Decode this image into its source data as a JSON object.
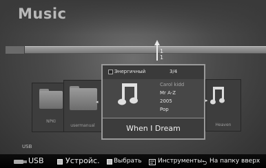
{
  "app": {
    "title": "Music"
  },
  "track": {
    "position_top": "1",
    "position_bottom": "1"
  },
  "left_folders": [
    {
      "label": "NPKI"
    },
    {
      "label": "usermanual"
    }
  ],
  "popup": {
    "genre_label": "Энергичный",
    "count": "3/4",
    "artist": "Carol kidd",
    "album": "Mr A-Z",
    "year": "2005",
    "genre": "Pop",
    "song_title": "When I Dream"
  },
  "right_tile": {
    "label": "Heaven"
  },
  "device_label": "USB",
  "bottom_bar": {
    "usb": "USB",
    "device": "Устройс.",
    "select": "Выбрать",
    "tools": "Инструменты",
    "back": "На папку вверх"
  },
  "icons": {
    "usb": "usb-stick-icon",
    "device": "square-button-icon",
    "select": "square-button-icon",
    "tools": "tools-icon",
    "back": "return-arrow-icon",
    "music": "music-note-icon",
    "folder": "folder-icon"
  },
  "colors": {
    "background": "#4a4a4a",
    "highlight_border": "#9a9a9a",
    "text": "#f2f2f2"
  }
}
